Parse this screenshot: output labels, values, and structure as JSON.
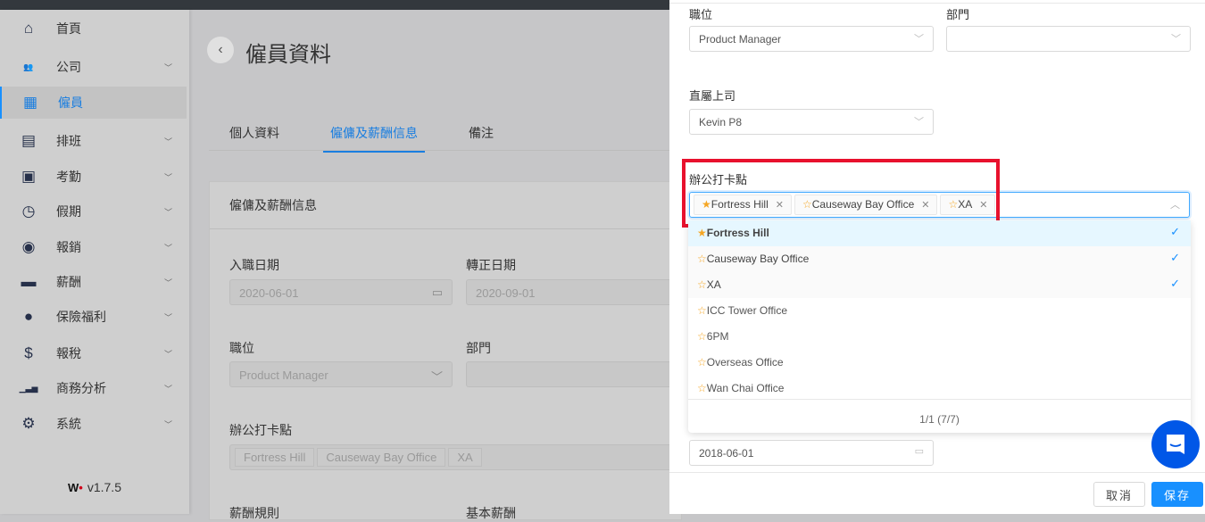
{
  "sidebar": {
    "items": [
      {
        "label": "首頁",
        "icon": "home-icon",
        "glyph": "⌂",
        "chevron": false
      },
      {
        "label": "公司",
        "icon": "users-icon",
        "glyph": "👥",
        "chevron": true
      },
      {
        "label": "僱員",
        "icon": "dashboard-icon",
        "glyph": "▦",
        "chevron": false,
        "active": true
      },
      {
        "label": "排班",
        "icon": "layout-icon",
        "glyph": "▤",
        "chevron": true
      },
      {
        "label": "考勤",
        "icon": "calendar-icon",
        "glyph": "▣",
        "chevron": true
      },
      {
        "label": "假期",
        "icon": "clock-calendar-icon",
        "glyph": "◷",
        "chevron": true
      },
      {
        "label": "報銷",
        "icon": "money-cycle-icon",
        "glyph": "◉",
        "chevron": true
      },
      {
        "label": "薪酬",
        "icon": "wallet-icon",
        "glyph": "▬",
        "chevron": true
      },
      {
        "label": "保險福利",
        "icon": "piggy-bank-icon",
        "glyph": "●",
        "chevron": true
      },
      {
        "label": "報稅",
        "icon": "money-bag-icon",
        "glyph": "$",
        "chevron": true
      },
      {
        "label": "商務分析",
        "icon": "bar-chart-icon",
        "glyph": "▁▃▅",
        "chevron": true
      },
      {
        "label": "系統",
        "icon": "gear-icon",
        "glyph": "⚙",
        "chevron": true
      }
    ],
    "version": "v1.7.5"
  },
  "main": {
    "title": "僱員資料",
    "tabs": [
      "個人資料",
      "僱傭及薪酬信息",
      "備注"
    ],
    "active_tab": 1,
    "card_title": "僱傭及薪酬信息",
    "join_date_label": "入職日期",
    "join_date": "2020-06-01",
    "confirm_date_label": "轉正日期",
    "confirm_date": "2020-09-01",
    "position_label": "職位",
    "position": "Product Manager",
    "department_label": "部門",
    "checkin_label": "辦公打卡點",
    "checkin_tags": [
      "Fortress Hill",
      "Causeway Bay Office",
      "XA"
    ],
    "salary_rule_label": "薪酬規則",
    "base_salary_label": "基本薪酬"
  },
  "drawer": {
    "position_label": "職位",
    "position": "Product Manager",
    "department_label": "部門",
    "department": "",
    "manager_label": "直屬上司",
    "manager": "Kevin P8",
    "checkin_label": "辦公打卡點",
    "tags": [
      {
        "label": "Fortress Hill",
        "starred": true
      },
      {
        "label": "Causeway Bay Office",
        "starred": false
      },
      {
        "label": "XA",
        "starred": false
      }
    ],
    "options": [
      {
        "label": "Fortress Hill",
        "starred": true,
        "selected": true
      },
      {
        "label": "Causeway Bay Office",
        "starred": false,
        "selected": true
      },
      {
        "label": "XA",
        "starred": false,
        "selected": true
      },
      {
        "label": "ICC Tower Office",
        "starred": false,
        "selected": false
      },
      {
        "label": "6PM",
        "starred": false,
        "selected": false
      },
      {
        "label": "Overseas Office",
        "starred": false,
        "selected": false
      },
      {
        "label": "Wan Chai Office",
        "starred": false,
        "selected": false
      }
    ],
    "pagination": "1/1 (7/7)",
    "date_value": "2018-06-01",
    "cancel": "取消",
    "save": "保存"
  },
  "colors": {
    "accent": "#1890ff",
    "highlight_box": "#e8112d",
    "star": "#f5a623",
    "chat": "#0057e7"
  }
}
